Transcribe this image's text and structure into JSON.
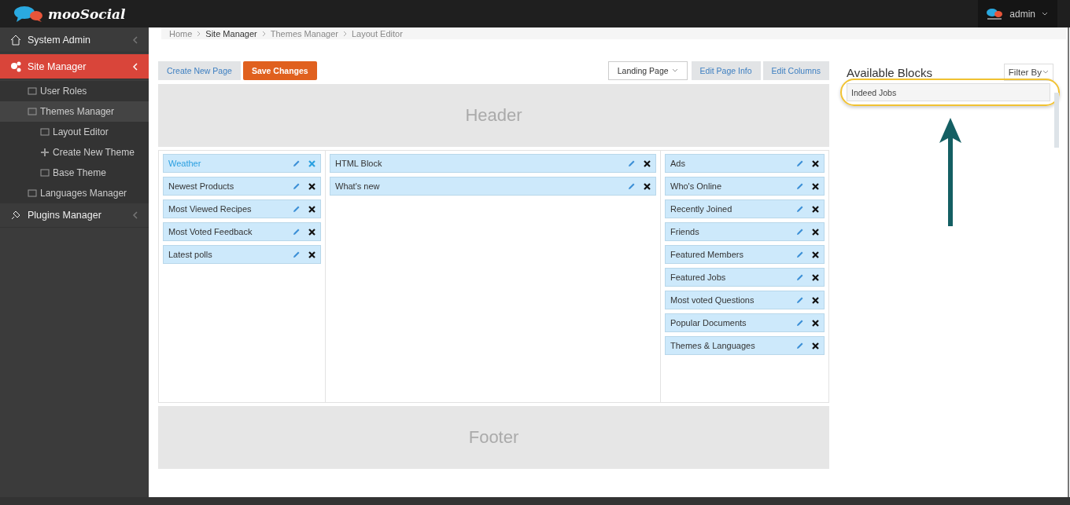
{
  "topbar": {
    "brand": "mooSocial",
    "user": "admin"
  },
  "sidebar": {
    "items": [
      {
        "label": "System Admin",
        "selected": false
      },
      {
        "label": "Site Manager",
        "selected": true,
        "children": [
          {
            "label": "User Roles",
            "selected": false
          },
          {
            "label": "Themes Manager",
            "selected": true,
            "children": [
              {
                "label": "Layout Editor",
                "selected": false
              },
              {
                "label": "Create New Theme",
                "selected": false
              },
              {
                "label": "Base Theme",
                "selected": false
              }
            ]
          },
          {
            "label": "Languages Manager",
            "selected": false
          }
        ]
      },
      {
        "label": "Plugins Manager",
        "selected": false
      }
    ]
  },
  "breadcrumb": [
    "Home",
    "Site Manager",
    "Themes Manager",
    "Layout Editor"
  ],
  "toolbar": {
    "create_button": "Create New Page",
    "save_button": "Save Changes",
    "page_select": "Landing Page",
    "edit_info_button": "Edit Page Info",
    "edit_columns_button": "Edit Columns"
  },
  "layout": {
    "header": "Header",
    "footer": "Footer",
    "columns": [
      {
        "blocks": [
          {
            "label": "Weather",
            "selected": true
          },
          {
            "label": "Newest Products",
            "selected": false
          },
          {
            "label": "Most Viewed Recipes",
            "selected": false
          },
          {
            "label": "Most Voted Feedback",
            "selected": false
          },
          {
            "label": "Latest polls",
            "selected": false
          }
        ]
      },
      {
        "blocks": [
          {
            "label": "HTML Block",
            "selected": false
          },
          {
            "label": "What's new",
            "selected": false
          }
        ]
      },
      {
        "blocks": [
          {
            "label": "Ads",
            "selected": false
          },
          {
            "label": "Who's Online",
            "selected": false
          },
          {
            "label": "Recently Joined",
            "selected": false
          },
          {
            "label": "Friends",
            "selected": false
          },
          {
            "label": "Featured Members",
            "selected": false
          },
          {
            "label": "Featured Jobs",
            "selected": false
          },
          {
            "label": "Most voted Questions",
            "selected": false
          },
          {
            "label": "Popular Documents",
            "selected": false
          },
          {
            "label": "Themes & Languages",
            "selected": false
          }
        ]
      }
    ]
  },
  "available": {
    "title": "Available Blocks",
    "filter": "Filter By",
    "blocks": [
      "Indeed Jobs"
    ]
  }
}
